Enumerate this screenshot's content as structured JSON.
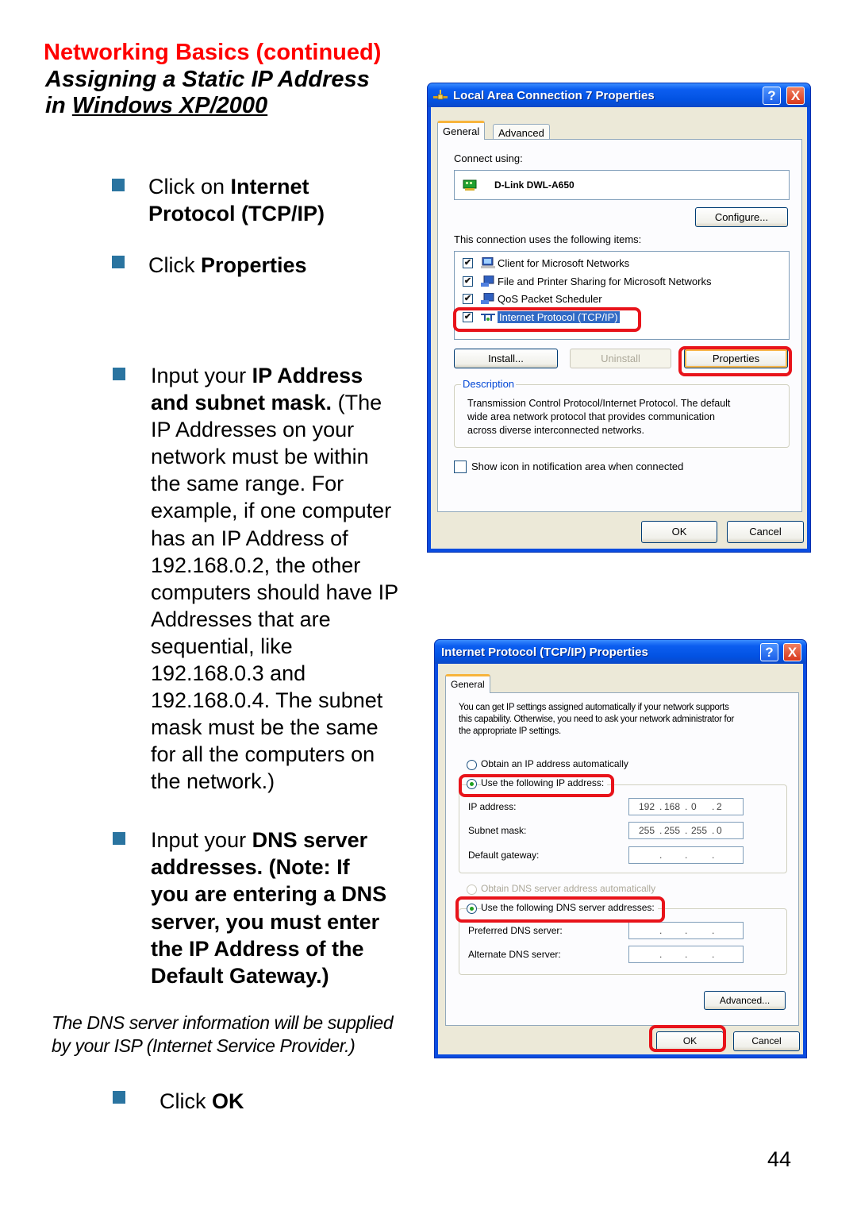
{
  "document": {
    "section_title": "Networking Basics (continued)",
    "subtitle_line1": "Assigning a Static IP Address",
    "subtitle_line2_prefix": "in ",
    "subtitle_line2_link": "Windows XP/2000",
    "page_number": "44",
    "accent_color": "#ff0000",
    "bullet_color": "#2a74a0"
  },
  "steps": [
    {
      "normal": "Click on ",
      "bold": "Internet",
      "line2_bold": "Protocol (TCP/IP)"
    },
    {
      "normal": "Click ",
      "bold": "Properties"
    },
    {
      "lines": [
        {
          "normal": "Input your ",
          "bold": "IP Address"
        },
        {
          "bold": "and subnet mask.",
          "normal": " (The"
        },
        {
          "normal": "IP Addresses on your"
        },
        {
          "normal": "network must be within"
        },
        {
          "normal": "the same range. For"
        },
        {
          "normal": "example, if one computer"
        },
        {
          "normal": "has an IP Address of"
        },
        {
          "normal": "192.168.0.2, the other"
        },
        {
          "normal": "computers should have IP"
        },
        {
          "normal": "Addresses that are"
        },
        {
          "normal": "sequential, like"
        },
        {
          "normal": "192.168.0.3 and"
        },
        {
          "normal": "192.168.0.4. The subnet"
        },
        {
          "normal": "mask must be the same"
        },
        {
          "normal": "for all the computers on"
        },
        {
          "normal": "the network.)"
        }
      ]
    },
    {
      "lines": [
        {
          "normal": "Input your ",
          "bold": "DNS server"
        },
        {
          "bold": "addresses. (Note:  If"
        },
        {
          "bold": "you are entering a DNS"
        },
        {
          "bold": "server, you must enter"
        },
        {
          "bold": "the IP Address of the"
        },
        {
          "bold": "Default Gateway.)"
        }
      ]
    },
    {
      "normal": "Click ",
      "bold": "OK"
    }
  ],
  "note": {
    "line1": "The DNS server information will be supplied",
    "line2": "by your ISP (Internet Service Provider.)"
  },
  "lan_dialog": {
    "title": "Local Area Connection 7 Properties",
    "title_icon": "network-connection-icon",
    "help_label": "?",
    "close_label": "X",
    "tabs": [
      "General",
      "Advanced"
    ],
    "active_tab": "General",
    "connect_using_label": "Connect using:",
    "adapter_name": "D-Link DWL-A650",
    "configure_label": "Configure...",
    "items_label": "This connection uses the following items:",
    "items": [
      {
        "label": "Client for Microsoft Networks",
        "checked": true,
        "icon": "client-network-icon"
      },
      {
        "label": "File and Printer Sharing for Microsoft Networks",
        "checked": true,
        "icon": "file-printer-sharing-icon"
      },
      {
        "label": "QoS Packet Scheduler",
        "checked": true,
        "icon": "qos-scheduler-icon"
      },
      {
        "label": "Internet Protocol (TCP/IP)",
        "checked": true,
        "icon": "protocol-icon",
        "selected": true
      }
    ],
    "install_label": "Install...",
    "uninstall_label": "Uninstall",
    "properties_label": "Properties",
    "description_label": "Description",
    "description_text_1": "Transmission Control Protocol/Internet Protocol. The default",
    "description_text_2": "wide area network protocol that provides communication",
    "description_text_3": "across diverse interconnected networks.",
    "show_icon_label": "Show icon in notification area when connected",
    "show_icon_checked": false,
    "ok_label": "OK",
    "cancel_label": "Cancel"
  },
  "tcpip_dialog": {
    "title": "Internet Protocol (TCP/IP) Properties",
    "help_label": "?",
    "close_label": "X",
    "tabs": [
      "General"
    ],
    "intro_1": "You can get IP settings assigned automatically if your network supports",
    "intro_2": "this capability. Otherwise, you need to ask your network administrator for",
    "intro_3": "the appropriate IP settings.",
    "obtain_ip_label": "Obtain an IP address automatically",
    "use_ip_label": "Use the following IP address:",
    "ip_mode": "static",
    "ip_address_label": "IP address:",
    "ip_address": [
      "192",
      "168",
      "0",
      "2"
    ],
    "subnet_label": "Subnet mask:",
    "subnet_mask": [
      "255",
      "255",
      "255",
      "0"
    ],
    "gateway_label": "Default gateway:",
    "gateway": [
      "",
      "",
      "",
      ""
    ],
    "obtain_dns_label": "Obtain DNS server address automatically",
    "use_dns_label": "Use the following DNS server addresses:",
    "dns_mode": "static",
    "preferred_dns_label": "Preferred DNS server:",
    "preferred_dns": [
      "",
      "",
      "",
      ""
    ],
    "alternate_dns_label": "Alternate DNS server:",
    "alternate_dns": [
      "",
      "",
      "",
      ""
    ],
    "advanced_label": "Advanced...",
    "ok_label": "OK",
    "cancel_label": "Cancel"
  },
  "highlight_color": "#e8131a"
}
